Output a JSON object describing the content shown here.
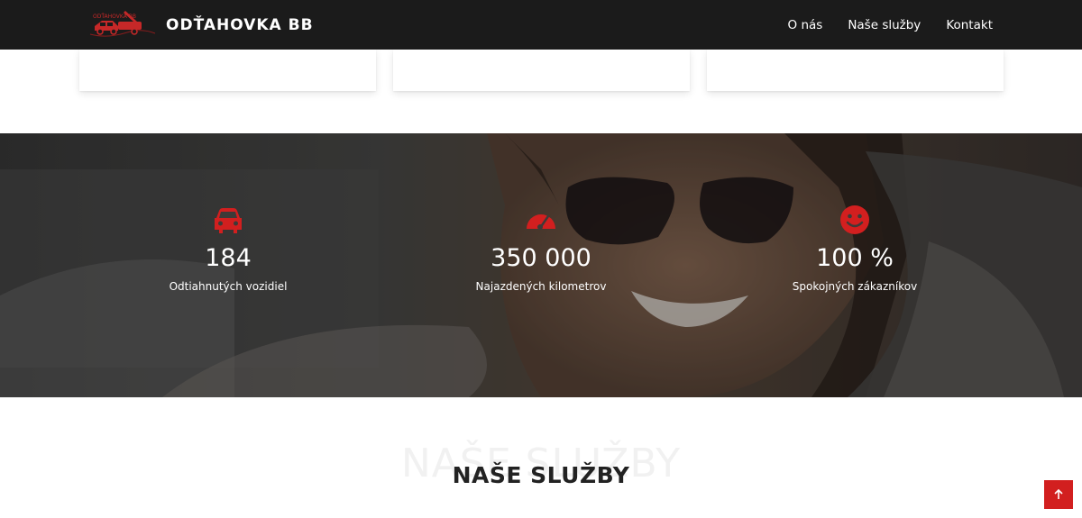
{
  "brand": {
    "logo_text": "ODŤAHOVKA BB",
    "name": "ODŤAHOVKA BB"
  },
  "nav": {
    "items": [
      {
        "label": "O nás"
      },
      {
        "label": "Naše služby"
      },
      {
        "label": "Kontakt"
      }
    ]
  },
  "stats": [
    {
      "icon": "car-icon",
      "value": "184",
      "label": "Odtiahnutých vozidiel"
    },
    {
      "icon": "speedometer-icon",
      "value": "350 000",
      "label": "Najazdených kilometrov"
    },
    {
      "icon": "smiley-icon",
      "value": "100 %",
      "label": "Spokojných zákazníkov"
    }
  ],
  "services": {
    "ghost_title": "NAŠE SLUŽBY",
    "title": "NAŠE SLUŽBY"
  },
  "back_to_top": {
    "icon": "arrow-up-icon"
  },
  "colors": {
    "accent": "#d21f1f",
    "navbar": "#1b1b1b"
  }
}
